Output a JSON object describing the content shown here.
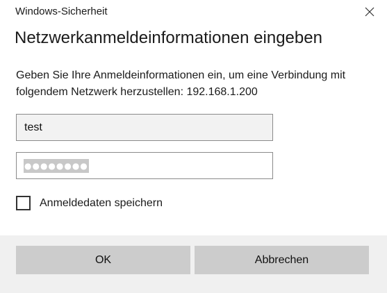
{
  "window": {
    "title": "Windows-Sicherheit"
  },
  "dialog": {
    "heading": "Netzwerkanmeldeinformationen eingeben",
    "description": "Geben Sie Ihre Anmeldeinformationen ein, um eine Verbindung mit folgendem Netzwerk herzustellen: 192.168.1.200"
  },
  "form": {
    "username_value": "test",
    "password_mask": "●●●●●●●●",
    "remember": {
      "label": "Anmeldedaten speichern",
      "checked": false
    }
  },
  "buttons": {
    "ok_label": "OK",
    "cancel_label": "Abbrechen"
  },
  "icons": {
    "close": "close-icon"
  },
  "colors": {
    "footer_bg": "#f0f0f0",
    "button_bg": "#cccccc",
    "username_field_bg": "#f2f2f2",
    "selection_bg": "#c8c8c8"
  }
}
